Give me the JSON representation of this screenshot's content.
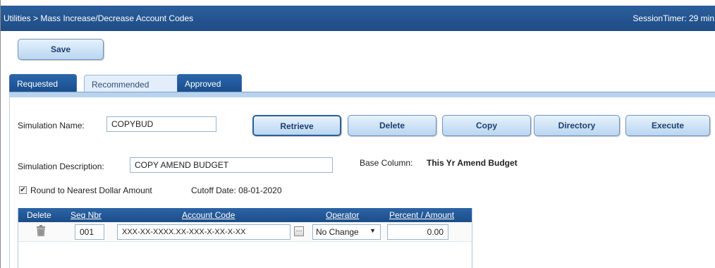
{
  "header": {
    "breadcrumb": "Utilities > Mass Increase/Decrease Account Codes",
    "session_timer": "SessionTimer: 29 min"
  },
  "toolbar": {
    "save_label": "Save"
  },
  "tabs": [
    {
      "label": "Requested",
      "active": false
    },
    {
      "label": "Recommended",
      "active": true
    },
    {
      "label": "Approved",
      "active": false
    }
  ],
  "form": {
    "simulation_name_label": "Simulation Name:",
    "simulation_name_value": "COPYBUD",
    "simulation_description_label": "Simulation Description:",
    "simulation_description_value": "COPY AMEND BUDGET",
    "base_column_label": "Base Column:",
    "base_column_value": "This Yr Amend Budget",
    "round_checkbox_label": "Round to Nearest Dollar Amount",
    "round_checked": true,
    "cutoff_date_label": "Cutoff Date: 08-01-2020"
  },
  "actions": {
    "retrieve": "Retrieve",
    "delete": "Delete",
    "copy": "Copy",
    "directory": "Directory",
    "execute": "Execute"
  },
  "grid": {
    "columns": [
      "Delete",
      "Seq Nbr",
      "Account Code",
      "Operator",
      "Percent / Amount"
    ],
    "rows": [
      {
        "seq_nbr": "001",
        "account_code": "XXX-XX-XXXX.XX-XXX-X-XX-X-XX",
        "operator": "No Change",
        "amount": "0.00"
      }
    ]
  },
  "colors": {
    "header_blue": "#1e4c86",
    "button_light_blue": "#b9d6f1",
    "tab_active_bg": "#e3eefa"
  },
  "icons": {
    "delete_row": "trash-icon",
    "account_picker": "ellipsis-icon",
    "checkbox": "checkmark-icon"
  }
}
